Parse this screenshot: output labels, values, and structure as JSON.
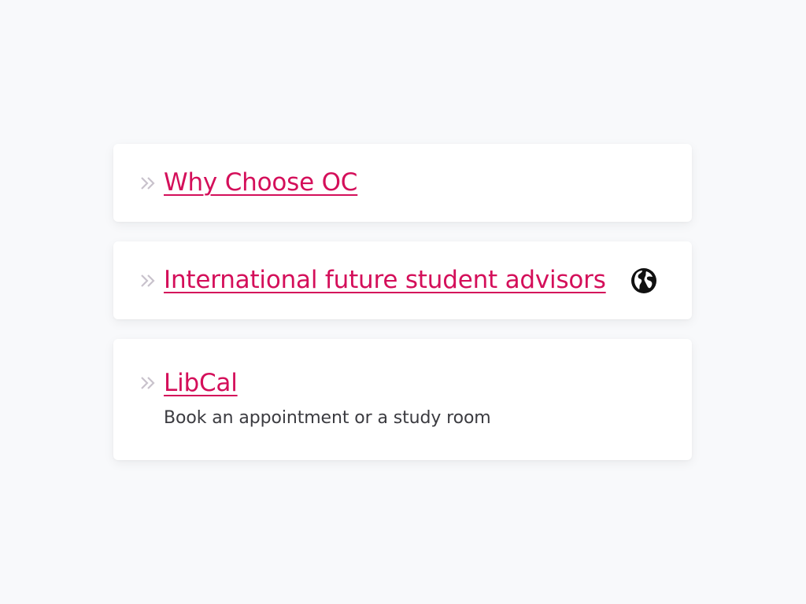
{
  "links": [
    {
      "label": "Why Choose OC",
      "description": null,
      "icon": null
    },
    {
      "label": "International future student advisors",
      "description": null,
      "icon": "globe-icon"
    },
    {
      "label": "LibCal",
      "description": "Book an appointment or a study room",
      "icon": null
    }
  ],
  "colors": {
    "background": "#f8f9fb",
    "card": "#ffffff",
    "link": "#d40f5a",
    "chevron": "#c8c2cc",
    "description": "#3b3b40",
    "icon": "#111111"
  }
}
